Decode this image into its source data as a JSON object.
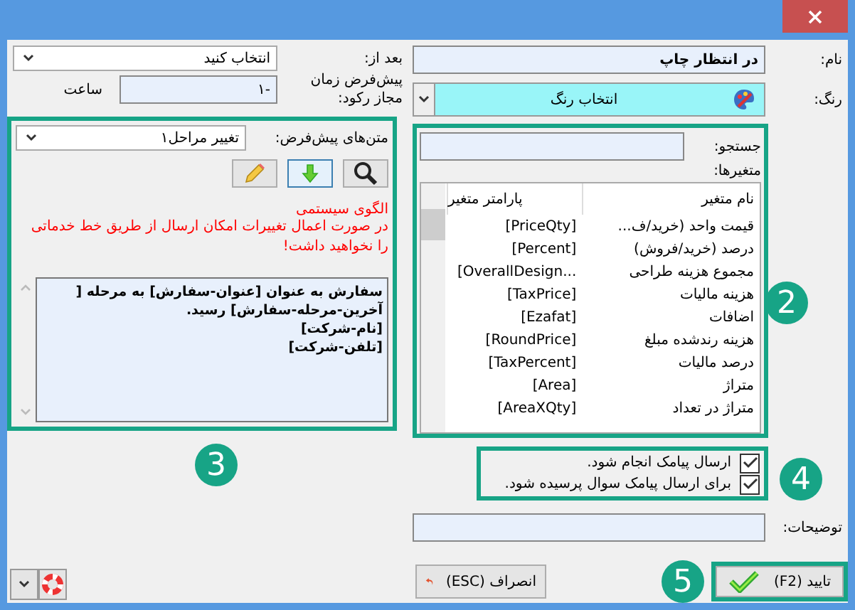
{
  "form": {
    "name_label": "نام:",
    "name_value": "در انتظار چاپ",
    "color_label": "رنگ:",
    "color_value": "انتخاب رنگ",
    "after_label": "بعد از:",
    "after_value": "انتخاب کنید",
    "idle_label": "پیش‌فرض زمان مجاز رکود:",
    "idle_value": "-۱",
    "idle_unit": "ساعت"
  },
  "variables": {
    "search_label": "جستجو:",
    "list_label": "متغیرها:",
    "columns": [
      "نام متغیر",
      "پارامتر متغیر"
    ],
    "rows": [
      [
        "قیمت واحد (خرید/ف...",
        "[PriceQty]"
      ],
      [
        "درصد (خرید/فروش)",
        "[Percent]"
      ],
      [
        "مجموع هزینه طراحی",
        "[OverallDesign..."
      ],
      [
        "هزینه مالیات",
        "[TaxPrice]"
      ],
      [
        "اضافات",
        "[Ezafat]"
      ],
      [
        "هزینه رندشده مبلغ",
        "[RoundPrice]"
      ],
      [
        "درصد مالیات",
        "[TaxPercent]"
      ],
      [
        "متراژ",
        "[Area]"
      ],
      [
        "متراژ در تعداد",
        "[AreaXQty]"
      ]
    ]
  },
  "templates": {
    "label": "متن‌های پیش‌فرض:",
    "value": "تغییر مراحل۱",
    "warning_title": "الگوی سیستمی",
    "warning_text": "در صورت اعمال تغییرات امکان ارسال از طریق خط خدماتی را نخواهید داشت!",
    "message": "سفارش به عنوان [عنوان-سفارش] به مرحله [\nآخرین-مرحله-سفارش] رسید.\n[نام-شرکت]\n[تلفن-شرکت]"
  },
  "options": [
    {
      "label": "ارسال پیامک انجام شود.",
      "checked": true
    },
    {
      "label": "برای ارسال پیامک سوال پرسیده شود.",
      "checked": true
    }
  ],
  "description_label": "توضیحات:",
  "buttons": {
    "confirm": "تایید (F2)",
    "cancel": "انصراف (ESC)"
  },
  "callouts": [
    "2",
    "3",
    "4",
    "5"
  ]
}
